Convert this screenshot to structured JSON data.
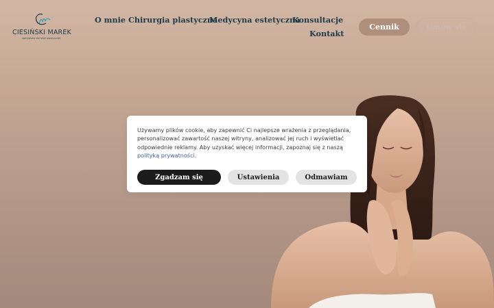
{
  "logo": {
    "name": "CIESIŃSKI MAREK",
    "subtitle": "specjalista chirurgii plastycznej",
    "color": "#1b3a4b",
    "accent": "#3fa3b5"
  },
  "nav": {
    "items": [
      {
        "label": "O mnie"
      },
      {
        "label": "Chirurgia plastyczna"
      },
      {
        "label": "Medycyna estetyczna"
      },
      {
        "label": "Konsultacje"
      },
      {
        "label": "Kontakt"
      }
    ],
    "cennik_label": "Cennik",
    "umow_label": "Umów się"
  },
  "cookie": {
    "text_before": "Używamy plików cookie, aby zapewnić Ci najlepsze wrażenia z przeglądania, personalizować zawartość naszej witryny, analizować jej ruch i wyświetlać odpowiednie reklamy. Aby uzyskać więcej informacji, zapoznaj się z naszą",
    "link_text": "polityką prywatności",
    "text_after": ".",
    "accept_label": "Zgadzam się",
    "settings_label": "Ustawienia",
    "reject_label": "Odmawiam"
  },
  "colors": {
    "cennik_bg": "#ad8f7c",
    "accept_bg": "#1c1c1c",
    "secondary_bg": "#e3e3e3",
    "link": "#3c5fa0"
  }
}
